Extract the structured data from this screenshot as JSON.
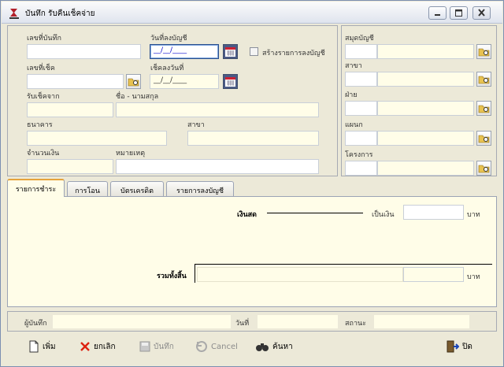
{
  "window": {
    "title": "บันทึก รับคืนเช็คจ่าย"
  },
  "form": {
    "doc_no_label": "เลขที่บันทึก",
    "doc_no_value": "",
    "post_date_label": "วันที่ลงบัญชี",
    "post_date_value": "__/__/____",
    "create_entry_label": "สร้างรายการลงบัญชี",
    "create_entry_checked": false,
    "cheque_no_label": "เลขที่เช็ค",
    "cheque_no_value": "",
    "cheque_date_label": "เช็คลงวันที่",
    "cheque_date_value": "__/__/____",
    "receive_from_label": "รับเช็คจาก",
    "name_label": "ชื่อ - นามสกุล",
    "bank_label": "ธนาคาร",
    "branch_label": "สาขา",
    "amount_label": "จำนวนเงิน",
    "remark_label": "หมายเหตุ"
  },
  "right_panel": {
    "book_label": "สมุดบัญชี",
    "branch_label": "สาขา",
    "section_label": "ฝ่าย",
    "dept_label": "แผนก",
    "project_label": "โครงการ"
  },
  "tabs": [
    {
      "label": "รายการชำระ"
    },
    {
      "label": "การโอน"
    },
    {
      "label": "บัตรเครดิต"
    },
    {
      "label": "รายการลงบัญชี"
    }
  ],
  "payment": {
    "cash_label": "เงินสด",
    "amount_label": "เป็นเงิน",
    "amount_value": "",
    "currency": "บาท",
    "total_label": "รวมทั้งสิ้น",
    "total_value": "",
    "total_currency": "บาท"
  },
  "footer": {
    "recorder_label": "ผู้บันทึก",
    "date_label": "วันที่",
    "status_label": "สถานะ"
  },
  "toolbar": {
    "add": "เพิ่ม",
    "cancel_doc": "ยกเลิก",
    "save": "บันทึก",
    "cancel": "Cancel",
    "search": "ค้นหา",
    "close": "ปิด"
  },
  "colors": {
    "field_bg": "#fffde8",
    "window_bg": "#ece9d8",
    "tab_accent": "#e6a43c"
  }
}
